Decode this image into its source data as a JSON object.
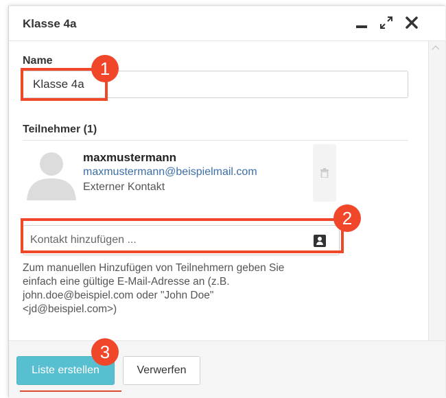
{
  "window": {
    "title": "Klasse 4a"
  },
  "name_field": {
    "label": "Name",
    "value": "Klasse 4a"
  },
  "participants": {
    "label": "Teilnehmer (1)",
    "items": [
      {
        "name": "maxmustermann",
        "email": "maxmustermann@beispielmail.com",
        "type": "Externer Kontakt"
      }
    ]
  },
  "contact_input": {
    "placeholder": "Kontakt hinzufügen ..."
  },
  "help_lines": [
    "Zum manuellen Hinzufügen von Teilnehmern geben Sie",
    "einfach eine gültige E-Mail-Adresse an (z.B.",
    "john.doe@beispiel.com oder \"John Doe\"",
    "<jd@beispiel.com>)"
  ],
  "buttons": {
    "create": "Liste erstellen",
    "discard": "Verwerfen"
  },
  "callouts": [
    "1",
    "2",
    "3"
  ],
  "colors": {
    "primary": "#58bfd0",
    "callout": "#f0462a",
    "link": "#3c6ea8"
  }
}
